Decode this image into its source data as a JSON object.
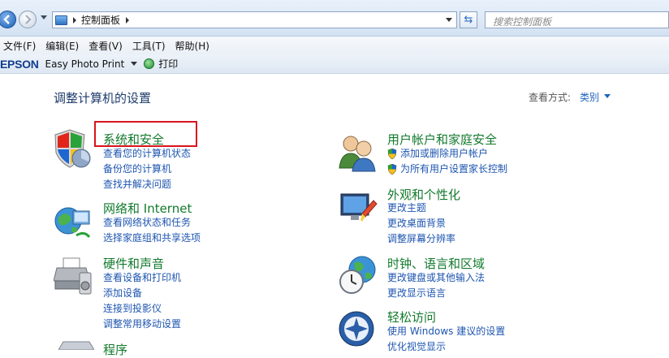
{
  "address": {
    "crumb": "控制面板",
    "search_placeholder": "搜索控制面板"
  },
  "menu": [
    "文件(F)",
    "编辑(E)",
    "查看(V)",
    "工具(T)",
    "帮助(H)"
  ],
  "toolbar": {
    "brand": "EPSON",
    "app": "Easy Photo Print",
    "print": "打印"
  },
  "page": {
    "title": "调整计算机的设置",
    "view_label": "查看方式:",
    "view_value": "类别"
  },
  "categories": [
    {
      "title": "系统和安全",
      "links": [
        "查看您的计算机状态",
        "备份您的计算机",
        "查找并解决问题"
      ]
    },
    {
      "title": "网络和 Internet",
      "links": [
        "查看网络状态和任务",
        "选择家庭组和共享选项"
      ]
    },
    {
      "title": "硬件和声音",
      "links": [
        "查看设备和打印机",
        "添加设备",
        "连接到投影仪",
        "调整常用移动设置"
      ]
    },
    {
      "title": "程序",
      "links": []
    },
    {
      "title": "用户帐户和家庭安全",
      "links": [
        "添加或删除用户帐户",
        "为所有用户设置家长控制"
      ]
    },
    {
      "title": "外观和个性化",
      "links": [
        "更改主题",
        "更改桌面背景",
        "调整屏幕分辨率"
      ]
    },
    {
      "title": "时钟、语言和区域",
      "links": [
        "更改键盘或其他输入法",
        "更改显示语言"
      ]
    },
    {
      "title": "轻松访问",
      "links": [
        "使用 Windows 建议的设置",
        "优化视觉显示"
      ]
    }
  ]
}
